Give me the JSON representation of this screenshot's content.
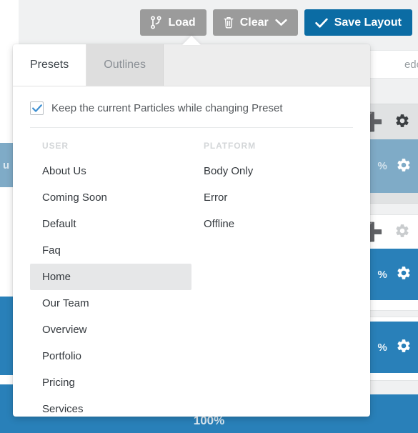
{
  "toolbar": {
    "load_label": "Load",
    "load_icon": "code-branch-icon",
    "clear_label": "Clear",
    "clear_icon": "trash-icon",
    "clear_caret_icon": "chevron-down-icon",
    "save_label": "Save Layout",
    "save_icon": "check-icon",
    "accent_blue": "#0b6ca4",
    "grey": "#9b9b9b"
  },
  "panel": {
    "tabs": [
      {
        "label": "Presets",
        "active": true
      },
      {
        "label": "Outlines",
        "active": false
      }
    ],
    "keep_particles": {
      "label": "Keep the current Particles while changing Preset",
      "checked": true,
      "check_color": "#3d8fd1"
    },
    "columns": [
      {
        "header": "USER",
        "items": [
          {
            "label": "About Us",
            "hover": false
          },
          {
            "label": "Coming Soon",
            "hover": false
          },
          {
            "label": "Default",
            "hover": false
          },
          {
            "label": "Faq",
            "hover": false
          },
          {
            "label": "Home",
            "hover": true
          },
          {
            "label": "Our Team",
            "hover": false
          },
          {
            "label": "Overview",
            "hover": false
          },
          {
            "label": "Portfolio",
            "hover": false
          },
          {
            "label": "Pricing",
            "hover": false
          },
          {
            "label": "Services",
            "hover": false
          }
        ]
      },
      {
        "header": "PLATFORM",
        "items": [
          {
            "label": "Body Only",
            "hover": false
          },
          {
            "label": "Error",
            "hover": false
          },
          {
            "label": "Offline",
            "hover": false
          }
        ]
      }
    ]
  },
  "background": {
    "redo_label": "edo",
    "redo_icon": "arrow-right-icon",
    "gear_icon": "gear-icon",
    "plus_icon": "plus-icon",
    "blue": "#2980b9",
    "pale_blue": "#7fabc7",
    "percent_labels": [
      "%",
      "%",
      "%",
      "%"
    ],
    "menu_fragment": "u",
    "bottom_percent": "100%"
  }
}
